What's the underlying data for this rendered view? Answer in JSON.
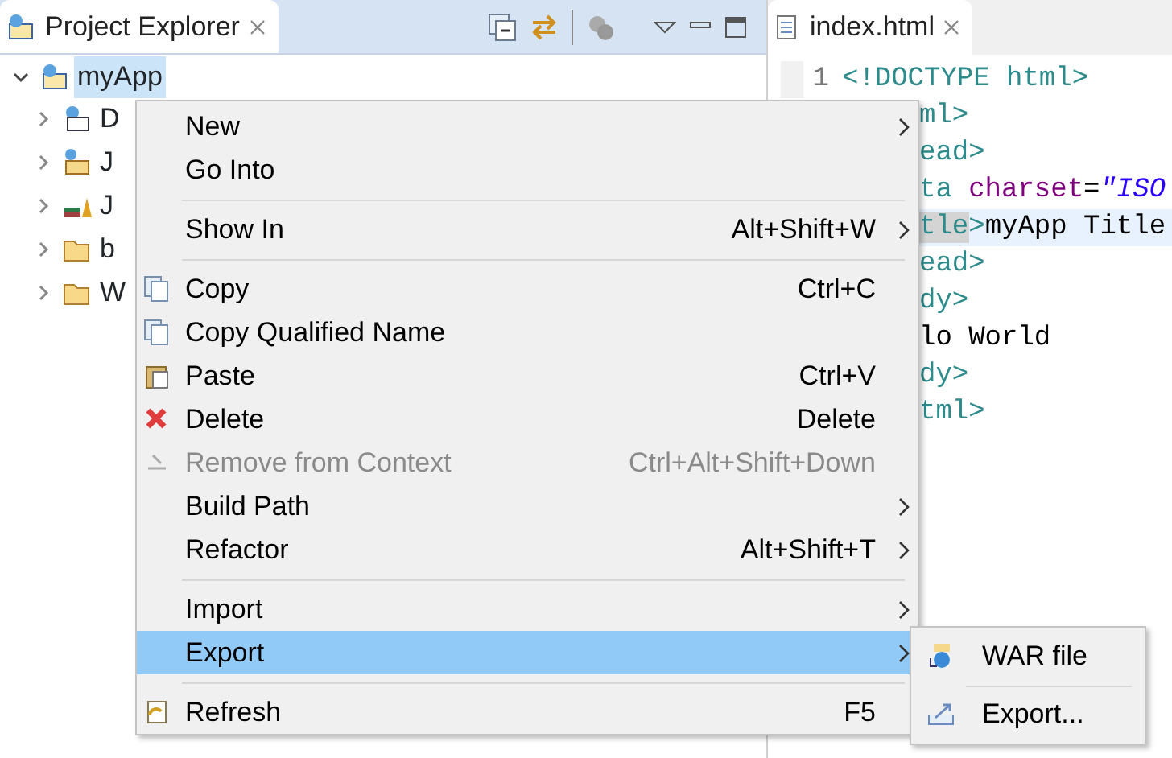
{
  "explorer": {
    "tab": {
      "title": "Project Explorer",
      "selected": true
    },
    "tree": [
      {
        "label": "myApp",
        "expanded": true,
        "selected": true,
        "children": [
          {
            "label": "D",
            "expanded": false,
            "selected": false
          },
          {
            "label": "J",
            "expanded": false,
            "selected": false
          },
          {
            "label": "J",
            "expanded": false,
            "selected": false
          },
          {
            "label": "b",
            "expanded": false,
            "selected": false
          },
          {
            "label": "W",
            "expanded": false,
            "selected": false
          }
        ]
      }
    ]
  },
  "editor": {
    "tab": {
      "title": "index.html",
      "selected": true
    },
    "lines": [
      {
        "number": "1",
        "current": false,
        "segments": [
          {
            "kind": "tag",
            "text": "<!DOCTYPE html>"
          }
        ]
      },
      {
        "current": false,
        "segments": [
          {
            "kind": "tag",
            "text": "ml>"
          }
        ]
      },
      {
        "current": false,
        "segments": [
          {
            "kind": "tag",
            "text": "ead>"
          }
        ]
      },
      {
        "current": false,
        "segments": [
          {
            "kind": "tag",
            "text": "ta "
          },
          {
            "kind": "attr",
            "text": "charset"
          },
          {
            "kind": "text",
            "text": "="
          },
          {
            "kind": "string",
            "text": "\"ISO"
          }
        ]
      },
      {
        "current": true,
        "segments": [
          {
            "kind": "match",
            "text": "tle"
          },
          {
            "kind": "tag",
            "text": ">"
          },
          {
            "kind": "text",
            "text": "myApp Title"
          }
        ]
      },
      {
        "current": false,
        "segments": [
          {
            "kind": "tag",
            "text": "ead>"
          }
        ]
      },
      {
        "current": false,
        "segments": [
          {
            "kind": "tag",
            "text": "dy>"
          }
        ]
      },
      {
        "current": false,
        "segments": [
          {
            "kind": "text",
            "text": "lo World"
          }
        ]
      },
      {
        "current": false,
        "segments": [
          {
            "kind": "tag",
            "text": "dy>"
          }
        ]
      },
      {
        "current": false,
        "segments": [
          {
            "kind": "tag",
            "text": "tml>"
          }
        ]
      }
    ]
  },
  "context_menu": {
    "items": [
      {
        "kind": "item",
        "label": "New",
        "submenu": true,
        "disabled": false,
        "selected": false
      },
      {
        "kind": "item",
        "label": "Go Into",
        "submenu": false,
        "disabled": false,
        "selected": false
      },
      {
        "kind": "separator"
      },
      {
        "kind": "item",
        "label": "Show In",
        "shortcut": "Alt+Shift+W",
        "submenu": true,
        "disabled": false,
        "selected": false
      },
      {
        "kind": "separator"
      },
      {
        "kind": "item",
        "label": "Copy",
        "shortcut": "Ctrl+C",
        "submenu": false,
        "disabled": false,
        "selected": false
      },
      {
        "kind": "item",
        "label": "Copy Qualified Name",
        "submenu": false,
        "disabled": false,
        "selected": false
      },
      {
        "kind": "item",
        "label": "Paste",
        "shortcut": "Ctrl+V",
        "submenu": false,
        "disabled": false,
        "selected": false
      },
      {
        "kind": "item",
        "label": "Delete",
        "shortcut": "Delete",
        "submenu": false,
        "disabled": false,
        "selected": false
      },
      {
        "kind": "item",
        "label": "Remove from Context",
        "shortcut": "Ctrl+Alt+Shift+Down",
        "submenu": false,
        "disabled": true,
        "selected": false
      },
      {
        "kind": "item",
        "label": "Build Path",
        "submenu": true,
        "disabled": false,
        "selected": false
      },
      {
        "kind": "item",
        "label": "Refactor",
        "shortcut": "Alt+Shift+T",
        "submenu": true,
        "disabled": false,
        "selected": false
      },
      {
        "kind": "separator"
      },
      {
        "kind": "item",
        "label": "Import",
        "submenu": true,
        "disabled": false,
        "selected": false
      },
      {
        "kind": "item",
        "label": "Export",
        "submenu": true,
        "disabled": false,
        "selected": true
      },
      {
        "kind": "separator"
      },
      {
        "kind": "item",
        "label": "Refresh",
        "shortcut": "F5",
        "submenu": false,
        "disabled": false,
        "selected": false
      }
    ]
  },
  "submenu": {
    "items": [
      {
        "kind": "item",
        "label": "WAR file",
        "selected": false
      },
      {
        "kind": "separator"
      },
      {
        "kind": "item",
        "label": "Export...",
        "selected": false
      }
    ]
  }
}
